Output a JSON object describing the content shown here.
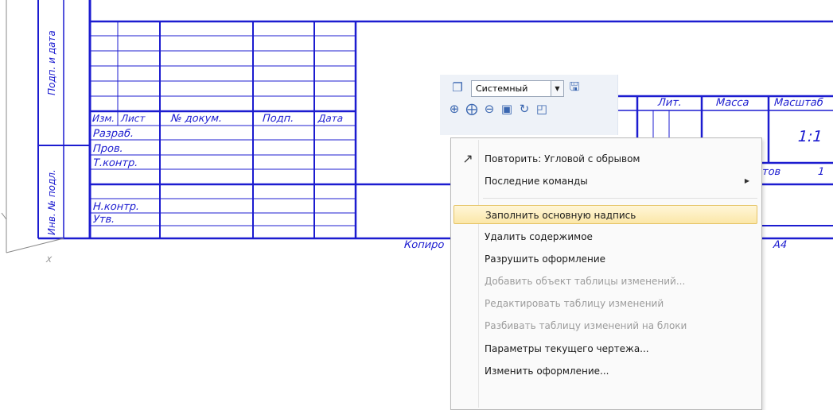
{
  "title_block": {
    "left_labels": [
      "Подп. и дата",
      "Инв. № подл."
    ],
    "header_cells": [
      "Изм.",
      "Лист",
      "№ докум.",
      "Подп.",
      "Дата"
    ],
    "row_labels": [
      "Разраб.",
      "Пров.",
      "Т.контр.",
      "Н.контр.",
      "Утв."
    ],
    "right_headers": [
      "Лит.",
      "Масса",
      "Масштаб"
    ],
    "scale_value": "1:1",
    "sheet_fragment": "тов",
    "sheet_number_fragment": "1",
    "copied_label": "Копиро",
    "format_label": "А4",
    "axis_label": "X"
  },
  "toolbar": {
    "style_value": "Системный",
    "icons": [
      "line-style-icon",
      "dropdown-arrow-icon",
      "save-icon",
      "zoom-window-icon",
      "zoom-in-icon",
      "zoom-out-icon",
      "show-all-icon",
      "refresh-icon",
      "zoom-scale-icon"
    ]
  },
  "context_menu": {
    "items": [
      {
        "label": "Повторить: Угловой с обрывом",
        "enabled": true,
        "icon": "polyline-icon"
      },
      {
        "label": "Последние команды",
        "enabled": true,
        "submenu": true
      },
      {
        "label": "Заполнить основную надпись",
        "enabled": true,
        "highlighted": true
      },
      {
        "label": "Удалить содержимое",
        "enabled": true
      },
      {
        "label": "Разрушить оформление",
        "enabled": true
      },
      {
        "label": "Добавить объект таблицы изменений...",
        "enabled": false
      },
      {
        "label": "Редактировать таблицу изменений",
        "enabled": false
      },
      {
        "label": "Разбивать таблицу изменений на блоки",
        "enabled": false
      },
      {
        "label": "Параметры текущего чертежа...",
        "enabled": true
      },
      {
        "label": "Изменить оформление...",
        "enabled": true
      }
    ]
  },
  "colors": {
    "drawing_line": "#1c1cd0",
    "highlight": "#fbe7a8",
    "toolbar_bg": "#eef2f8"
  }
}
